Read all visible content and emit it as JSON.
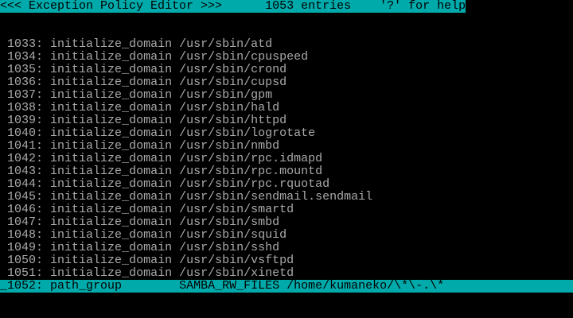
{
  "header": {
    "title": "<<< Exception Policy Editor >>>",
    "entries": "1053 entries",
    "help": "'?' for help"
  },
  "colors": {
    "highlight": "#00aaaa",
    "text": "#aaaaaa",
    "background": "#000000"
  },
  "entries": [
    {
      "index": "1033:",
      "directive": "initialize_domain",
      "value": "/usr/sbin/atd"
    },
    {
      "index": "1034:",
      "directive": "initialize_domain",
      "value": "/usr/sbin/cpuspeed"
    },
    {
      "index": "1035:",
      "directive": "initialize_domain",
      "value": "/usr/sbin/crond"
    },
    {
      "index": "1036:",
      "directive": "initialize_domain",
      "value": "/usr/sbin/cupsd"
    },
    {
      "index": "1037:",
      "directive": "initialize_domain",
      "value": "/usr/sbin/gpm"
    },
    {
      "index": "1038:",
      "directive": "initialize_domain",
      "value": "/usr/sbin/hald"
    },
    {
      "index": "1039:",
      "directive": "initialize_domain",
      "value": "/usr/sbin/httpd"
    },
    {
      "index": "1040:",
      "directive": "initialize_domain",
      "value": "/usr/sbin/logrotate"
    },
    {
      "index": "1041:",
      "directive": "initialize_domain",
      "value": "/usr/sbin/nmbd"
    },
    {
      "index": "1042:",
      "directive": "initialize_domain",
      "value": "/usr/sbin/rpc.idmapd"
    },
    {
      "index": "1043:",
      "directive": "initialize_domain",
      "value": "/usr/sbin/rpc.mountd"
    },
    {
      "index": "1044:",
      "directive": "initialize_domain",
      "value": "/usr/sbin/rpc.rquotad"
    },
    {
      "index": "1045:",
      "directive": "initialize_domain",
      "value": "/usr/sbin/sendmail.sendmail"
    },
    {
      "index": "1046:",
      "directive": "initialize_domain",
      "value": "/usr/sbin/smartd"
    },
    {
      "index": "1047:",
      "directive": "initialize_domain",
      "value": "/usr/sbin/smbd"
    },
    {
      "index": "1048:",
      "directive": "initialize_domain",
      "value": "/usr/sbin/squid"
    },
    {
      "index": "1049:",
      "directive": "initialize_domain",
      "value": "/usr/sbin/sshd"
    },
    {
      "index": "1050:",
      "directive": "initialize_domain",
      "value": "/usr/sbin/vsftpd"
    },
    {
      "index": "1051:",
      "directive": "initialize_domain",
      "value": "/usr/sbin/xinetd"
    }
  ],
  "selected": {
    "cursor": "_",
    "index": "1052:",
    "directive": "path_group",
    "value": "SAMBA_RW_FILES /home/kumaneko/\\*\\-.\\*"
  }
}
